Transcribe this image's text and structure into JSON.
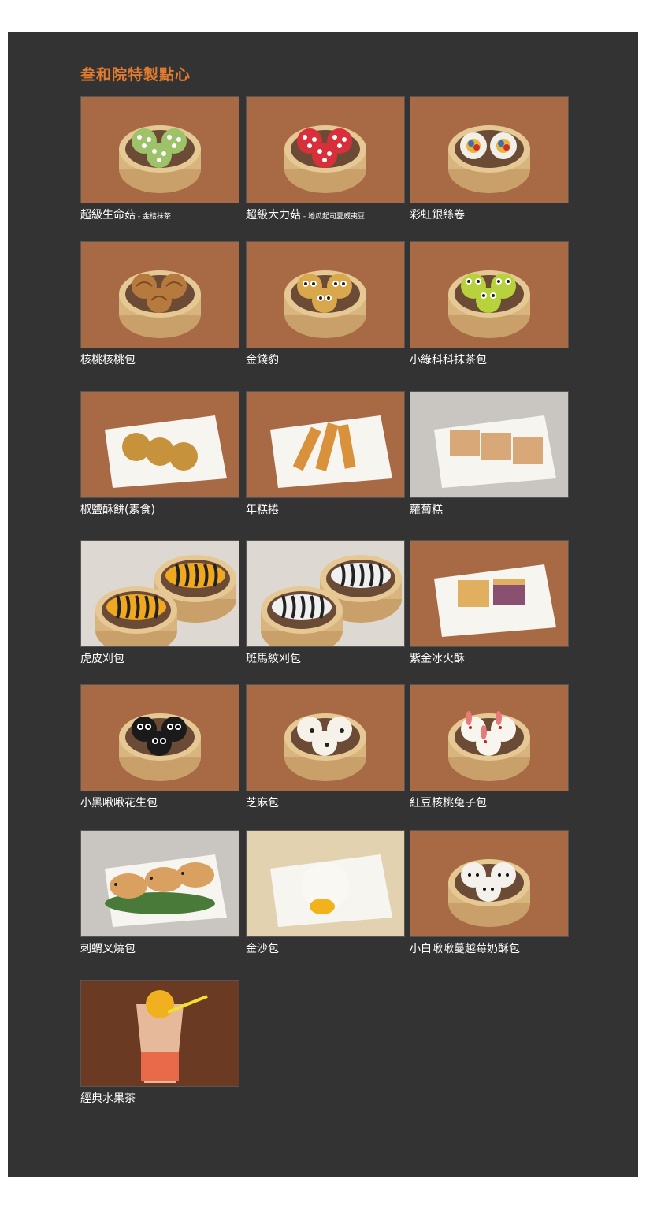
{
  "page": {
    "title": "叁和院特製點心",
    "accent_color": "#e07b2f",
    "panel_color": "#333333"
  },
  "items": [
    {
      "name": "超級生命菇",
      "sub": " - 金桔抹茶",
      "scene": "steamer",
      "food": "mushroom-green"
    },
    {
      "name": "超級大力菇",
      "sub": " - 地瓜起司夏威夷豆",
      "scene": "steamer",
      "food": "mushroom-red"
    },
    {
      "name": "彩虹銀絲卷",
      "sub": "",
      "scene": "steamer",
      "food": "rainbow-roll"
    },
    {
      "name": "核桃核桃包",
      "sub": "",
      "scene": "steamer",
      "food": "walnut-bun"
    },
    {
      "name": "金錢豹",
      "sub": "",
      "scene": "steamer",
      "food": "leopard-bun"
    },
    {
      "name": "小綠科科抹茶包",
      "sub": "",
      "scene": "steamer",
      "food": "frog-bun"
    },
    {
      "name": "椒鹽酥餅(素食)",
      "sub": "",
      "scene": "plate",
      "food": "sesame-cake"
    },
    {
      "name": "年糕捲",
      "sub": "",
      "scene": "plate",
      "food": "rice-cake-roll"
    },
    {
      "name": "蘿蔔糕",
      "sub": "",
      "scene": "plate",
      "food": "turnip-cake"
    },
    {
      "name": "虎皮刈包",
      "sub": "",
      "scene": "steamer-pair",
      "food": "tiger-bun"
    },
    {
      "name": "斑馬紋刈包",
      "sub": "",
      "scene": "steamer-pair",
      "food": "zebra-bun"
    },
    {
      "name": "紫金冰火酥",
      "sub": "",
      "scene": "plate",
      "food": "purple-pastry"
    },
    {
      "name": "小黑啾啾花生包",
      "sub": "",
      "scene": "steamer",
      "food": "black-bun"
    },
    {
      "name": "芝麻包",
      "sub": "",
      "scene": "steamer",
      "food": "sesame-bun"
    },
    {
      "name": "紅豆核桃兔子包",
      "sub": "",
      "scene": "steamer",
      "food": "rabbit-bun"
    },
    {
      "name": "刺蝟叉燒包",
      "sub": "",
      "scene": "plate",
      "food": "hedgehog-bun"
    },
    {
      "name": "金沙包",
      "sub": "",
      "scene": "plate",
      "food": "custard-bun"
    },
    {
      "name": "小白啾啾蔓越莓奶酥包",
      "sub": "",
      "scene": "steamer",
      "food": "white-bun"
    },
    {
      "name": "經典水果茶",
      "sub": "",
      "scene": "drink",
      "food": "fruit-tea"
    }
  ]
}
